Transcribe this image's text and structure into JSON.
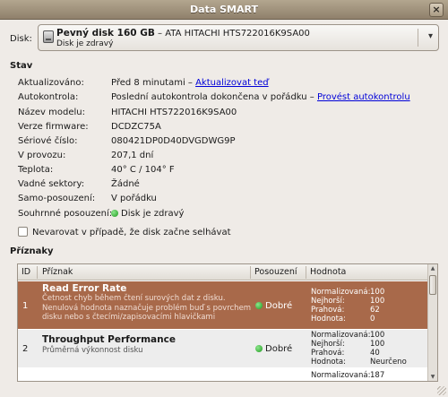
{
  "window": {
    "title": "Data SMART",
    "close_glyph": "×"
  },
  "disk": {
    "label": "Disk:",
    "name": "Pevný disk 160 GB",
    "detail": " – ATA HITACHI HTS722016K9SA00",
    "status": "Disk je zdravý",
    "icon": "hard-disk-icon"
  },
  "stav": {
    "heading": "Stav",
    "rows": [
      {
        "label": "Aktualizováno:",
        "value": "Před 8 minutami – ",
        "link": "Aktualizovat teď"
      },
      {
        "label": "Autokontrola:",
        "value": "Poslední autokontrola dokončena v pořádku – ",
        "link": "Provést autokontrolu"
      },
      {
        "label": "Název modelu:",
        "value": "HITACHI HTS722016K9SA00"
      },
      {
        "label": "Verze firmware:",
        "value": "DCDZC75A"
      },
      {
        "label": "Sériové číslo:",
        "value": "080421DP0D40DVGDWG9P"
      },
      {
        "label": "V provozu:",
        "value": "207,1 dní"
      },
      {
        "label": "Teplota:",
        "value": "40° C / 104° F"
      },
      {
        "label": "Vadné sektory:",
        "value": "Žádné"
      },
      {
        "label": "Samo-posouzení:",
        "value": "V pořádku"
      },
      {
        "label": "Souhrnné posouzení:",
        "value": "Disk je zdravý",
        "status_color": "#2aa52a"
      }
    ],
    "checkbox_label": "Nevarovat v případě, že disk začne selhávat",
    "checkbox_checked": false
  },
  "priznaky": {
    "heading": "Příznaky",
    "columns": [
      "ID",
      "Příznak",
      "Posouzení",
      "Hodnota"
    ],
    "value_keys": [
      "Normalizovaná:",
      "Nejhorší:",
      "Prahová:",
      "Hodnota:"
    ],
    "rows": [
      {
        "id": "1",
        "name": "Read Error Rate",
        "desc": "Četnost chyb během čtení surových dat z disku. Nenulová hodnota naznačuje problém buď s povrchem disku nebo s čtecími/zapisovacími hlavičkami",
        "assessment": "Dobré",
        "normalized": "100",
        "worst": "100",
        "threshold": "62",
        "value": "0",
        "selected": true
      },
      {
        "id": "2",
        "name": "Throughput Performance",
        "desc": "Průměrná výkonnost disku",
        "assessment": "Dobré",
        "normalized": "100",
        "worst": "100",
        "threshold": "40",
        "value": "Neurčeno",
        "selected": false
      },
      {
        "id": "",
        "name": "",
        "desc": "",
        "assessment": "",
        "normalized": "187",
        "worst": "",
        "threshold": "",
        "value": "",
        "selected": false
      }
    ]
  },
  "colors": {
    "selection": "#a8694a",
    "link": "#0000d8",
    "good": "#2aa52a",
    "titlebar": "#8f806b"
  }
}
